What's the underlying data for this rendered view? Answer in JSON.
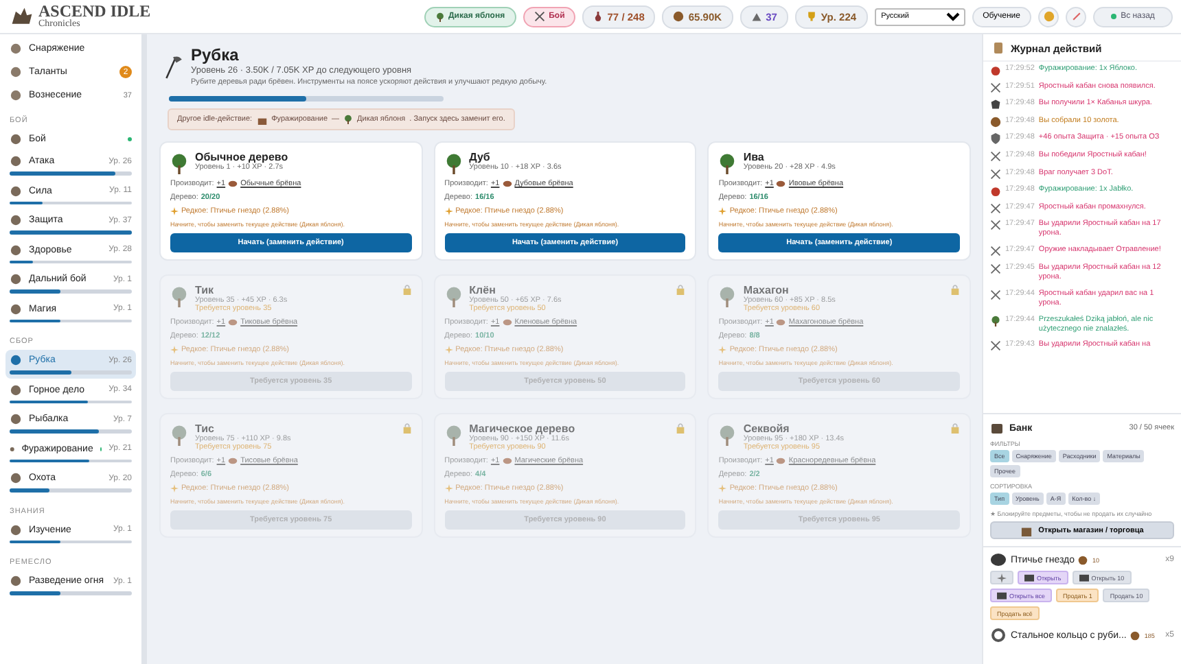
{
  "app": {
    "logo_title": "ASCEND IDLE",
    "logo_subtitle": "Chronicles"
  },
  "top_bar": {
    "current_action": "Дикая яблоня",
    "combat": "Бой",
    "stats": [
      {
        "kind": "potion",
        "text": "77 / 248"
      },
      {
        "kind": "coin",
        "text": "65.90K"
      },
      {
        "kind": "ascend",
        "text": "37"
      },
      {
        "kind": "trophy",
        "text": "Ур. 224"
      }
    ],
    "language": "Русский",
    "tutorial": "Обучение",
    "back": "Вс назад"
  },
  "sidebar": {
    "items": [
      {
        "kind": "link",
        "label": "Снаряжение"
      },
      {
        "kind": "link",
        "label": "Таланты",
        "badge": "2"
      },
      {
        "kind": "link",
        "label": "Вознесение",
        "counter": "37"
      },
      {
        "kind": "section",
        "label": "БОЙ"
      },
      {
        "kind": "skill",
        "label": "Бой",
        "active": true,
        "selected": false
      },
      {
        "kind": "skill",
        "label": "Атака",
        "level_text": "Ур. 26",
        "level": 0.87,
        "active": false,
        "selected": false
      },
      {
        "kind": "skill",
        "label": "Сила",
        "level_text": "Ур. 11",
        "level": 0.27,
        "active": false,
        "selected": false
      },
      {
        "kind": "skill",
        "label": "Защита",
        "level_text": "Ур. 37",
        "level": 1,
        "active": false,
        "selected": false
      },
      {
        "kind": "skill",
        "label": "Здоровье",
        "level_text": "Ур. 28",
        "level": 0.19,
        "active": false,
        "selected": false
      },
      {
        "kind": "skill",
        "label": "Дальний бой",
        "level_text": "Ур. 1",
        "level": 0.42,
        "active": false,
        "selected": false
      },
      {
        "kind": "skill",
        "label": "Магия",
        "level_text": "Ур. 1",
        "level": 0.42,
        "active": false,
        "selected": false
      },
      {
        "kind": "section",
        "label": "СБОР"
      },
      {
        "kind": "skill",
        "label": "Рубка",
        "level_text": "Ур. 26",
        "level": 0.5,
        "active": false,
        "selected": true
      },
      {
        "kind": "skill",
        "label": "Горное дело",
        "level_text": "Ур. 34",
        "level": 0.64,
        "active": false,
        "selected": false
      },
      {
        "kind": "skill",
        "label": "Рыбалка",
        "level_text": "Ур. 7",
        "level": 0.73,
        "active": false,
        "selected": false
      },
      {
        "kind": "skill",
        "label": "Фуражирование",
        "level_text": "Ур. 21",
        "level": 0.65,
        "active": true,
        "selected": false
      },
      {
        "kind": "skill",
        "label": "Охота",
        "level_text": "Ур. 20",
        "level": 0.33,
        "active": false,
        "selected": false
      },
      {
        "kind": "section",
        "label": "ЗНАНИЯ"
      },
      {
        "kind": "skill",
        "label": "Изучение",
        "level_text": "Ур. 1",
        "level": 0.42,
        "active": false,
        "selected": false
      },
      {
        "kind": "section",
        "label": "РЕМЕСЛО"
      },
      {
        "kind": "skill",
        "label": "Разведение огня",
        "level_text": "Ур. 1",
        "level": 0.42,
        "active": false,
        "selected": false
      }
    ]
  },
  "skill": {
    "title": "Рубка",
    "level_line": "Уровень 26 · 3.50K / 7.05K XP до следующего уровня",
    "description": "Рубите деревья ради брёвен. Инструменты на поясе ускоряют действия и улучшают редкую добычу.",
    "level": 0.5,
    "other_action": {
      "prefix": "Другое idle-действие:",
      "action": "Фуражирование",
      "separator": "—",
      "target": "Дикая яблоня",
      "suffix": ". Запуск здесь заменит его."
    }
  },
  "trees": [
    {
      "name": "Обычное дерево",
      "meta": "Уровень 1 · +10 XP · 2.7s",
      "locked": false,
      "produces_label": "Производит:",
      "amount": "+1",
      "item": "Обычные брёвна",
      "wood_label": "Дерево:",
      "wood": "20/20",
      "rare": "Редкое: Птичье гнездо (2.88%)",
      "hint": "Начните, чтобы заменить текущее действие (Дикая яблоня).",
      "button": "Начать (заменить действие)"
    },
    {
      "name": "Дуб",
      "meta": "Уровень 10 · +18 XP · 3.6s",
      "locked": false,
      "produces_label": "Производит:",
      "amount": "+1",
      "item": "Дубовые брёвна",
      "wood_label": "Дерево:",
      "wood": "16/16",
      "rare": "Редкое: Птичье гнездо (2.88%)",
      "hint": "Начните, чтобы заменить текущее действие (Дикая яблоня).",
      "button": "Начать (заменить действие)"
    },
    {
      "name": "Ива",
      "meta": "Уровень 20 · +28 XP · 4.9s",
      "locked": false,
      "produces_label": "Производит:",
      "amount": "+1",
      "item": "Ивовые брёвна",
      "wood_label": "Дерево:",
      "wood": "16/16",
      "rare": "Редкое: Птичье гнездо (2.88%)",
      "hint": "Начните, чтобы заменить текущее действие (Дикая яблоня).",
      "button": "Начать (заменить действие)"
    },
    {
      "name": "Тик",
      "meta": "Уровень 35 · +45 XP · 6.3s",
      "required": "Требуется уровень 35",
      "locked": true,
      "produces_label": "Производит:",
      "amount": "+1",
      "item": "Тиковые брёвна",
      "wood_label": "Дерево:",
      "wood": "12/12",
      "rare": "Редкое: Птичье гнездо (2.88%)",
      "hint": "Начните, чтобы заменить текущее действие (Дикая яблоня).",
      "button": "Требуется уровень 35"
    },
    {
      "name": "Клён",
      "meta": "Уровень 50 · +65 XP · 7.6s",
      "required": "Требуется уровень 50",
      "locked": true,
      "produces_label": "Производит:",
      "amount": "+1",
      "item": "Кленовые брёвна",
      "wood_label": "Дерево:",
      "wood": "10/10",
      "rare": "Редкое: Птичье гнездо (2.88%)",
      "hint": "Начните, чтобы заменить текущее действие (Дикая яблоня).",
      "button": "Требуется уровень 50"
    },
    {
      "name": "Махагон",
      "meta": "Уровень 60 · +85 XP · 8.5s",
      "required": "Требуется уровень 60",
      "locked": true,
      "produces_label": "Производит:",
      "amount": "+1",
      "item": "Махагоновые брёвна",
      "wood_label": "Дерево:",
      "wood": "8/8",
      "rare": "Редкое: Птичье гнездо (2.88%)",
      "hint": "Начните, чтобы заменить текущее действие (Дикая яблоня).",
      "button": "Требуется уровень 60"
    },
    {
      "name": "Тис",
      "meta": "Уровень 75 · +110 XP · 9.8s",
      "required": "Требуется уровень 75",
      "locked": true,
      "produces_label": "Производит:",
      "amount": "+1",
      "item": "Тисовые брёвна",
      "wood_label": "Дерево:",
      "wood": "6/6",
      "rare": "Редкое: Птичье гнездо (2.88%)",
      "hint": "Начните, чтобы заменить текущее действие (Дикая яблоня).",
      "button": "Требуется уровень 75"
    },
    {
      "name": "Магическое дерево",
      "meta": "Уровень 90 · +150 XP · 11.6s",
      "required": "Требуется уровень 90",
      "locked": true,
      "produces_label": "Производит:",
      "amount": "+1",
      "item": "Магические брёвна",
      "wood_label": "Дерево:",
      "wood": "4/4",
      "rare": "Редкое: Птичье гнездо (2.88%)",
      "hint": "Начните, чтобы заменить текущее действие (Дикая яблоня).",
      "button": "Требуется уровень 90"
    },
    {
      "name": "Секвойя",
      "meta": "Уровень 95 · +180 XP · 13.4s",
      "required": "Требуется уровень 95",
      "locked": true,
      "produces_label": "Производит:",
      "amount": "+1",
      "item": "Красноредевные брёвна",
      "wood_label": "Дерево:",
      "wood": "2/2",
      "rare": "Редкое: Птичье гнездо (2.88%)",
      "hint": "Начните, чтобы заменить текущее действие (Дикая яблоня).",
      "button": "Требуется уровень 95"
    }
  ],
  "log": {
    "title": "Журнал действий",
    "entries": [
      {
        "kind": "gather",
        "time": "17:29:52",
        "text": "Фуражирование: 1x Яблоко."
      },
      {
        "kind": "combat",
        "time": "17:29:51",
        "text": "Яростный кабан снова появился."
      },
      {
        "kind": "loot",
        "time": "17:29:48",
        "text": "Вы получили 1× Кабанья шкура."
      },
      {
        "kind": "gold",
        "time": "17:29:48",
        "text": "Вы собрали 10 золота."
      },
      {
        "kind": "xp",
        "time": "17:29:48",
        "text": "+46 опыта Защита · +15 опыта ОЗ"
      },
      {
        "kind": "combat",
        "time": "17:29:48",
        "text": "Вы победили Яростный кабан!"
      },
      {
        "kind": "combat",
        "time": "17:29:48",
        "text": "Враг получает 3 DoT."
      },
      {
        "kind": "gather",
        "time": "17:29:48",
        "text": "Фуражирование: 1x Jabłko."
      },
      {
        "kind": "combat",
        "time": "17:29:47",
        "text": "Яростный кабан промахнулся."
      },
      {
        "kind": "combat",
        "time": "17:29:47",
        "text": "Вы ударили Яростный кабан на 17 урона."
      },
      {
        "kind": "combat",
        "time": "17:29:47",
        "text": "Оружие накладывает Отравление!"
      },
      {
        "kind": "combat",
        "time": "17:29:45",
        "text": "Вы ударили Яростный кабан на 12 урона."
      },
      {
        "kind": "combat",
        "time": "17:29:44",
        "text": "Яростный кабан ударил вас на 1 урона."
      },
      {
        "kind": "forage",
        "time": "17:29:44",
        "text": "Przeszukałeś Dziką jabłoń, ale nic użytecznego nie znalazłeś."
      },
      {
        "kind": "combat",
        "time": "17:29:43",
        "text": "Вы ударили Яростный кабан на"
      }
    ]
  },
  "bank": {
    "title": "Банк",
    "capacity": "30 / 50 ячеек",
    "filters_label": "ФИЛЬТРЫ",
    "filters": [
      {
        "label": "Все",
        "selected": true
      },
      {
        "label": "Снаряжение",
        "selected": false
      },
      {
        "label": "Расходники",
        "selected": false
      },
      {
        "label": "Материалы",
        "selected": false
      },
      {
        "label": "Прочее",
        "selected": false
      }
    ],
    "sort_label": "СОРТИРОВКА",
    "sorts": [
      {
        "label": "Тип",
        "selected": true
      },
      {
        "label": "Уровень",
        "selected": false
      },
      {
        "label": "А-Я",
        "selected": false
      },
      {
        "label": "Кол-во ↓",
        "selected": false
      }
    ],
    "hint": "★ Блокируйте предметы, чтобы не продать их случайно",
    "shop_button": "Открыть магазин / торговца",
    "items": [
      {
        "name": "Птичье гнездо",
        "price": "10",
        "count": "x9",
        "actions": [
          {
            "kind": "lock"
          },
          {
            "kind": "open",
            "label": "Открыть",
            "primary": true
          },
          {
            "kind": "open",
            "label": "Открыть 10",
            "primary": false
          },
          {
            "kind": "open",
            "label": "Открыть все",
            "primary": true
          },
          {
            "kind": "sell",
            "label": "Продать 1",
            "primary": true
          },
          {
            "kind": "sell",
            "label": "Продать 10",
            "primary": false
          },
          {
            "kind": "sell",
            "label": "Продать всё",
            "primary": true
          }
        ]
      },
      {
        "name": "Стальное кольцо с руби...",
        "price": "185",
        "count": "x5"
      }
    ]
  }
}
